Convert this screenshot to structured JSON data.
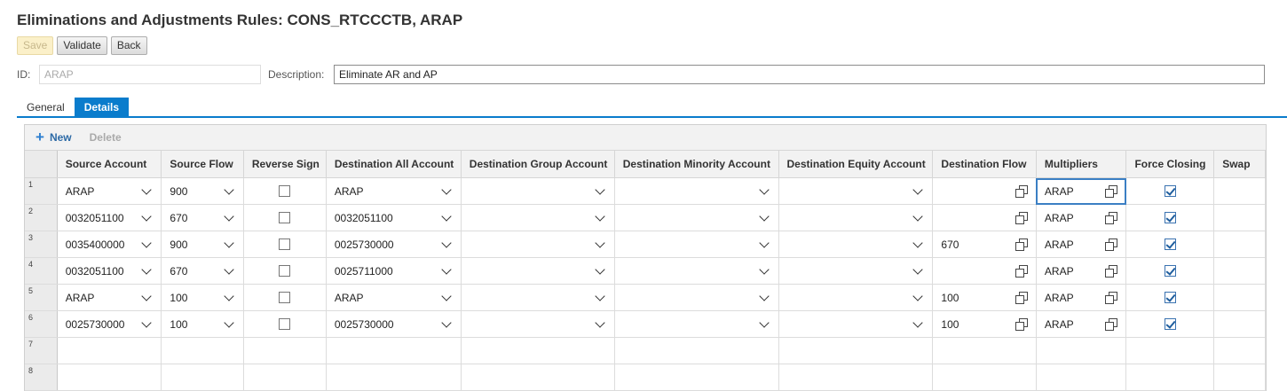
{
  "page": {
    "title": "Eliminations and Adjustments Rules: CONS_RTCCCTB, ARAP"
  },
  "actions": {
    "save": "Save",
    "validate": "Validate",
    "back": "Back"
  },
  "form": {
    "id_label": "ID:",
    "id_value": "ARAP",
    "description_label": "Description:",
    "description_value": "Eliminate AR and AP"
  },
  "tabs": [
    {
      "label": "General",
      "active": false
    },
    {
      "label": "Details",
      "active": true
    }
  ],
  "toolbar": {
    "new": "New",
    "delete": "Delete"
  },
  "table": {
    "columns": [
      "Source Account",
      "Source Flow",
      "Reverse Sign",
      "Destination All Account",
      "Destination Group Account",
      "Destination Minority Account",
      "Destination Equity Account",
      "Destination Flow",
      "Multipliers",
      "Force Closing",
      "Swap"
    ],
    "rows": [
      {
        "n": "1",
        "src_acct": "ARAP",
        "src_flow": "900",
        "reverse": false,
        "dest_all": "ARAP",
        "dest_group": "",
        "dest_min": "",
        "dest_eq": "",
        "dest_flow": "",
        "mult": "ARAP",
        "force": true
      },
      {
        "n": "2",
        "src_acct": "0032051100",
        "src_flow": "670",
        "reverse": false,
        "dest_all": "0032051100",
        "dest_group": "",
        "dest_min": "",
        "dest_eq": "",
        "dest_flow": "",
        "mult": "ARAP",
        "force": true
      },
      {
        "n": "3",
        "src_acct": "0035400000",
        "src_flow": "900",
        "reverse": false,
        "dest_all": "0025730000",
        "dest_group": "",
        "dest_min": "",
        "dest_eq": "",
        "dest_flow": "670",
        "mult": "ARAP",
        "force": true
      },
      {
        "n": "4",
        "src_acct": "0032051100",
        "src_flow": "670",
        "reverse": false,
        "dest_all": "0025711000",
        "dest_group": "",
        "dest_min": "",
        "dest_eq": "",
        "dest_flow": "",
        "mult": "ARAP",
        "force": true
      },
      {
        "n": "5",
        "src_acct": "ARAP",
        "src_flow": "100",
        "reverse": false,
        "dest_all": "ARAP",
        "dest_group": "",
        "dest_min": "",
        "dest_eq": "",
        "dest_flow": "100",
        "mult": "ARAP",
        "force": true
      },
      {
        "n": "6",
        "src_acct": "0025730000",
        "src_flow": "100",
        "reverse": false,
        "dest_all": "0025730000",
        "dest_group": "",
        "dest_min": "",
        "dest_eq": "",
        "dest_flow": "100",
        "mult": "ARAP",
        "force": true
      }
    ],
    "empty_rows": [
      "7",
      "8"
    ]
  },
  "colors": {
    "accent": "#0a7ccc",
    "save_disabled_bg": "#fbf0c9"
  },
  "icons": {
    "new": "plus-icon",
    "dropdown": "chevron-down-icon",
    "value_help": "copy-icon"
  }
}
